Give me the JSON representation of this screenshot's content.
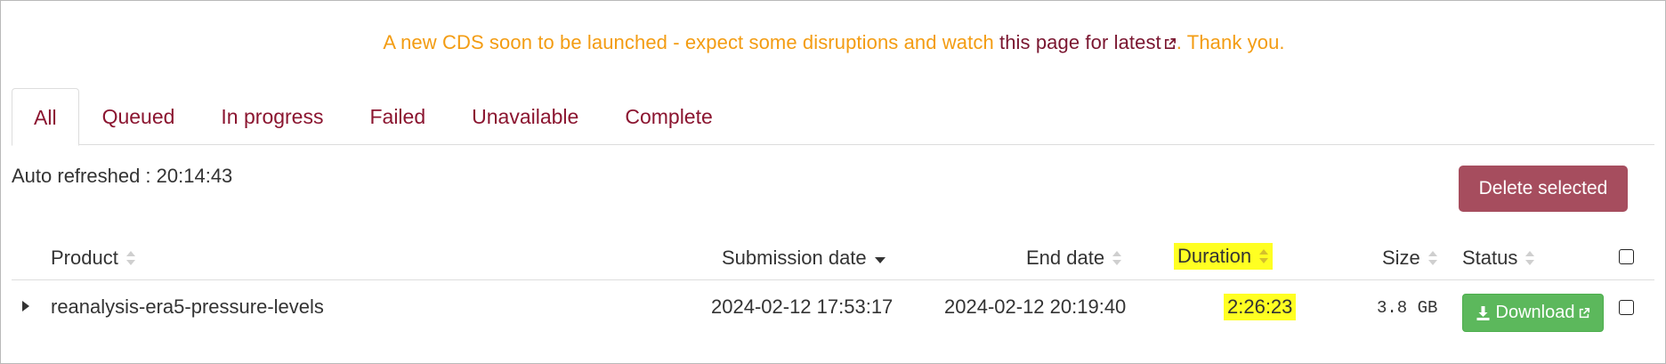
{
  "banner": {
    "text_before": "A new CDS soon to be launched - expect some disruptions and watch ",
    "link_text": "this page for latest",
    "text_after": ". Thank you."
  },
  "tabs": [
    {
      "label": "All",
      "active": true
    },
    {
      "label": "Queued",
      "active": false
    },
    {
      "label": "In progress",
      "active": false
    },
    {
      "label": "Failed",
      "active": false
    },
    {
      "label": "Unavailable",
      "active": false
    },
    {
      "label": "Complete",
      "active": false
    }
  ],
  "auto_refreshed": "Auto refreshed : 20:14:43",
  "delete_selected_label": "Delete selected",
  "table": {
    "columns": {
      "product": "Product",
      "submission_date": "Submission date",
      "end_date": "End date",
      "duration": "Duration",
      "size": "Size",
      "status": "Status"
    },
    "sorted_column": "Submission date",
    "sort_direction": "descending",
    "rows": [
      {
        "product": "reanalysis-era5-pressure-levels",
        "submission_date": "2024-02-12 17:53:17",
        "end_date": "2024-02-12 20:19:40",
        "duration": "2:26:23",
        "size": "3.8 GB",
        "status_label": "Download"
      }
    ]
  },
  "colors": {
    "banner_text": "#f39c12",
    "banner_link": "#7a1630",
    "tab_text": "#8b1530",
    "delete_button": "#a64d5e",
    "download_button": "#5cb85c",
    "highlight": "#ffff22"
  }
}
